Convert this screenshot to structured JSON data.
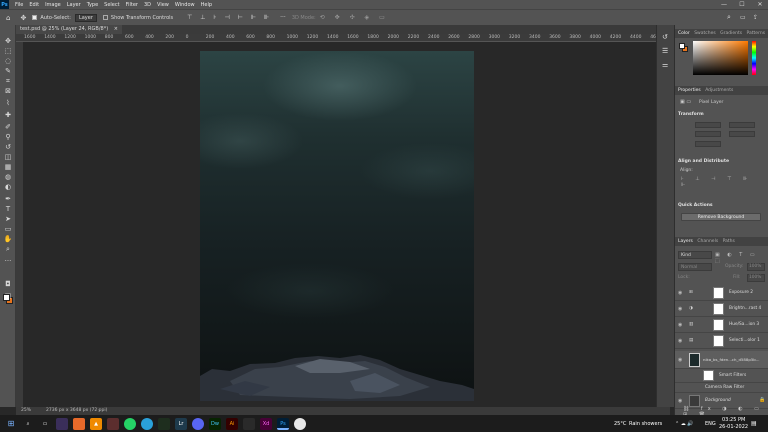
{
  "menu": {
    "logo": "Ps",
    "items": [
      "File",
      "Edit",
      "Image",
      "Layer",
      "Type",
      "Select",
      "Filter",
      "3D",
      "View",
      "Window",
      "Help"
    ],
    "minimize": "—",
    "maximize": "☐",
    "close": "✕"
  },
  "options": {
    "auto_select_label": "Auto-Select:",
    "auto_select_value": "Layer",
    "show_transform_label": "Show Transform Controls",
    "mode_3d": "3D Mode:"
  },
  "document": {
    "tab_title": "test.psd @ 25% (Layer 24, RGB/8*)",
    "tab_close": "×",
    "ruler_ticks": [
      "1600",
      "1400",
      "1200",
      "1000",
      "800",
      "600",
      "400",
      "200",
      "0",
      "200",
      "400",
      "600",
      "800",
      "1000",
      "1200",
      "1400",
      "1600",
      "1800",
      "2000",
      "2200",
      "2400",
      "2600",
      "2800",
      "3000",
      "3200",
      "3400",
      "3600",
      "3800",
      "4000",
      "4200",
      "4400",
      "4600"
    ]
  },
  "status": {
    "zoom": "25%",
    "doc_size": "2736 px x 3648 px (72 ppi)"
  },
  "panels": {
    "color_tabs": [
      "Color",
      "Swatches",
      "Gradients",
      "Patterns"
    ],
    "properties_tabs": [
      "Properties",
      "Adjustments"
    ],
    "pixel_layer": "Pixel Layer",
    "transform": "Transform",
    "align": "Align and Distribute",
    "align_sub": "Align:",
    "quick_actions": "Quick Actions",
    "remove_bg": "Remove Background",
    "layers_tabs": [
      "Layers",
      "Channels",
      "Paths"
    ],
    "kind": "Kind",
    "opacity_label": "Opacity:",
    "opacity": "100%",
    "fill_label": "Fill:",
    "fill": "100%",
    "lock_label": "Lock:",
    "blend_mode": "Normal"
  },
  "layers": [
    {
      "name": "Exposure 2"
    },
    {
      "name": "Brightn...rast 4"
    },
    {
      "name": "Hue/Sa...ion 3"
    },
    {
      "name": "Selecti...olor 1"
    },
    {
      "name": "nika_bs_fden...ch_d588p5b..."
    },
    {
      "name": "Smart Filters"
    },
    {
      "name": "Camera Raw Filter"
    },
    {
      "name": "Background"
    }
  ],
  "taskbar": {
    "weather_temp": "25°C",
    "weather_text": "Rain showers",
    "lang": "ENG",
    "time": "03:25 PM",
    "date": "26-01-2022"
  },
  "colors": {
    "foreground": "#ffffff",
    "background": "#e8741c",
    "accent": "#31a8ff"
  }
}
